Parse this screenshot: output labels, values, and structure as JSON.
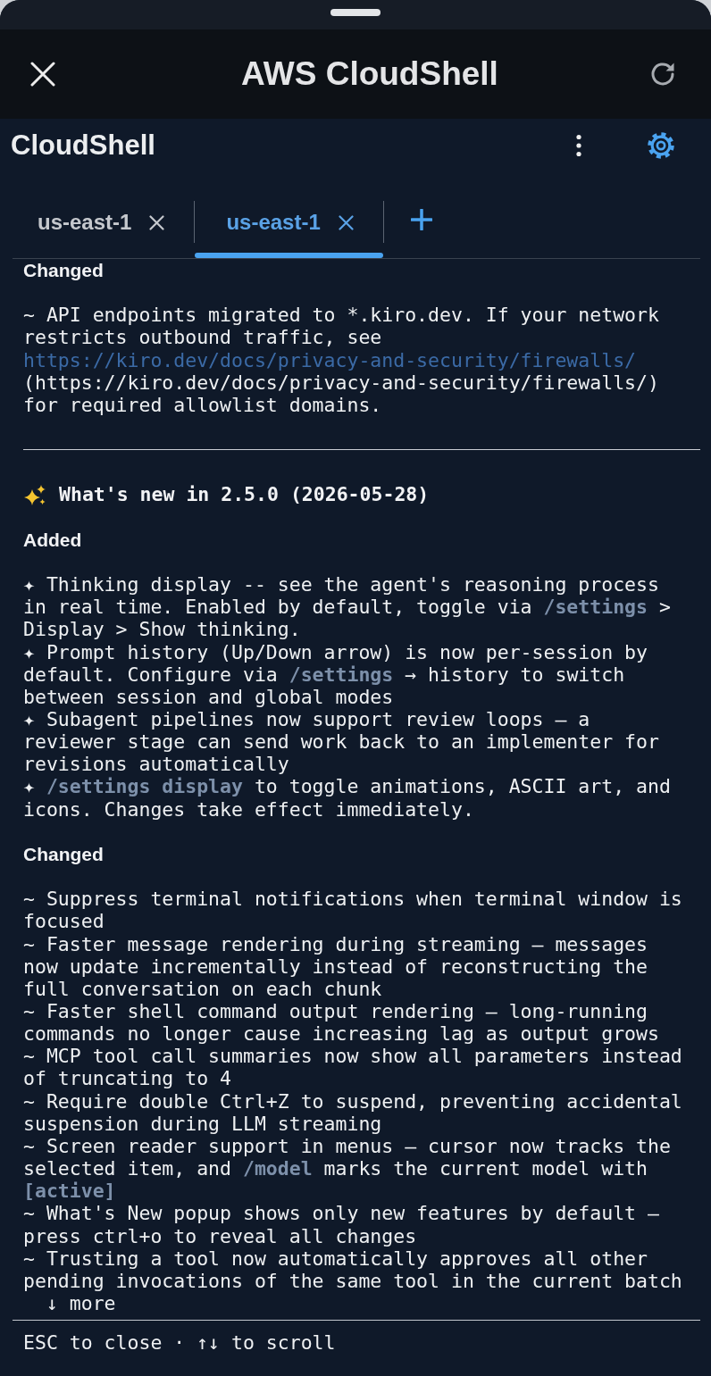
{
  "top_bar": {
    "title": "AWS CloudShell"
  },
  "app_bar": {
    "title": "CloudShell"
  },
  "tabs": [
    {
      "label": "us-east-1",
      "selected": false
    },
    {
      "label": "us-east-1",
      "selected": true
    }
  ],
  "releases": [
    {
      "sections": [
        {
          "heading": "Changed",
          "items": [
            {
              "text": "~ API endpoints migrated to *.kiro.dev. If your network restricts outbound traffic, see",
              "link": "https://kiro.dev/docs/privacy-and-security/firewalls/",
              "after": "(https://kiro.dev/docs/privacy-and-security/firewalls/) for required allowlist domains."
            }
          ]
        }
      ]
    },
    {
      "title": "What's new in 2.5.0 (2026-05-28)",
      "sections": [
        {
          "heading": "Added",
          "items": [
            {
              "text": "✦ Thinking display -- see the agent's reasoning process in real time. Enabled by default, toggle via **/settings** > Display > Show thinking."
            },
            {
              "text": "✦ Prompt history (Up/Down arrow) is now per-session by default. Configure via **/settings** → history to switch between session and global modes"
            },
            {
              "text": "✦ Subagent pipelines now support review loops — a reviewer stage can send work back to an implementer for revisions automatically"
            },
            {
              "text": "✦ **/settings display** to toggle animations, ASCII art, and icons. Changes take effect immediately."
            }
          ]
        },
        {
          "heading": "Changed",
          "items": [
            {
              "text": "~ Suppress terminal notifications when terminal window is focused"
            },
            {
              "text": "~ Faster message rendering during streaming — messages now update incrementally instead of reconstructing the full conversation on each chunk"
            },
            {
              "text": "~ Faster shell command output rendering — long-running commands no longer cause increasing lag as output grows"
            },
            {
              "text": "~ MCP tool call summaries now show all parameters instead of truncating to 4"
            },
            {
              "text": "~ Require double Ctrl+Z to suspend, preventing accidental suspension during LLM streaming"
            },
            {
              "text": "~ Screen reader support in menus — cursor now tracks the selected item, and **/model** marks the current model with **[active]**"
            },
            {
              "text": "~ What's New popup shows only new features by default — press ctrl+o to reveal all changes"
            },
            {
              "text": "~ Trusting a tool now automatically approves all other pending invocations of the same tool in the current batch"
            }
          ]
        }
      ]
    }
  ],
  "more_indicator": "↓ more",
  "footer_hint": "ESC to close · ↑↓ to scroll"
}
